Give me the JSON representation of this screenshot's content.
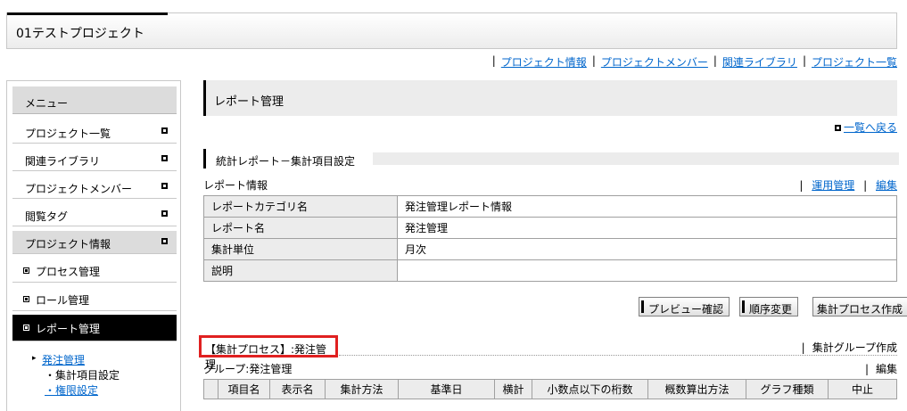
{
  "header": {
    "project_title": "01テストプロジェクト"
  },
  "top_nav": {
    "links": [
      "プロジェクト情報",
      "プロジェクトメンバー",
      "関連ライブラリ",
      "プロジェクト一覧"
    ]
  },
  "sidebar": {
    "menu_label": "メニュー",
    "items": [
      {
        "label": "プロジェクト一覧"
      },
      {
        "label": "関連ライブラリ"
      },
      {
        "label": "プロジェクトメンバー"
      },
      {
        "label": "閲覧タグ"
      },
      {
        "label": "プロジェクト情報"
      }
    ],
    "sub_items": [
      {
        "label": "プロセス管理"
      },
      {
        "label": "ロール管理"
      },
      {
        "label": "レポート管理"
      }
    ],
    "tree": {
      "parent": "発注管理",
      "children": [
        "・集計項目設定",
        "・権限設定"
      ]
    }
  },
  "main": {
    "page_title": "レポート管理",
    "back_link": "一覧へ戻る",
    "section_title": "統計レポート－集計項目設定",
    "report_info_label": "レポート情報",
    "report_links": [
      "運用管理",
      "編集"
    ],
    "info_rows": [
      {
        "key": "レポートカテゴリ名",
        "value": "発注管理レポート情報"
      },
      {
        "key": "レポート名",
        "value": "発注管理"
      },
      {
        "key": "集計単位",
        "value": "月次"
      },
      {
        "key": "説明",
        "value": ""
      }
    ],
    "buttons": {
      "preview": "プレビュー確認",
      "reorder": "順序変更",
      "create_process": "集計プロセス作成"
    },
    "process_title": "【集計プロセス】:発注管理",
    "group_create": "集計グループ作成",
    "group_label": "グループ:発注管理",
    "group_edit": "編集",
    "columns": [
      "項目名",
      "表示名",
      "集計方法",
      "基準日",
      "横計",
      "小数点以下の桁数",
      "概数算出方法",
      "グラフ種類",
      "中止"
    ]
  }
}
